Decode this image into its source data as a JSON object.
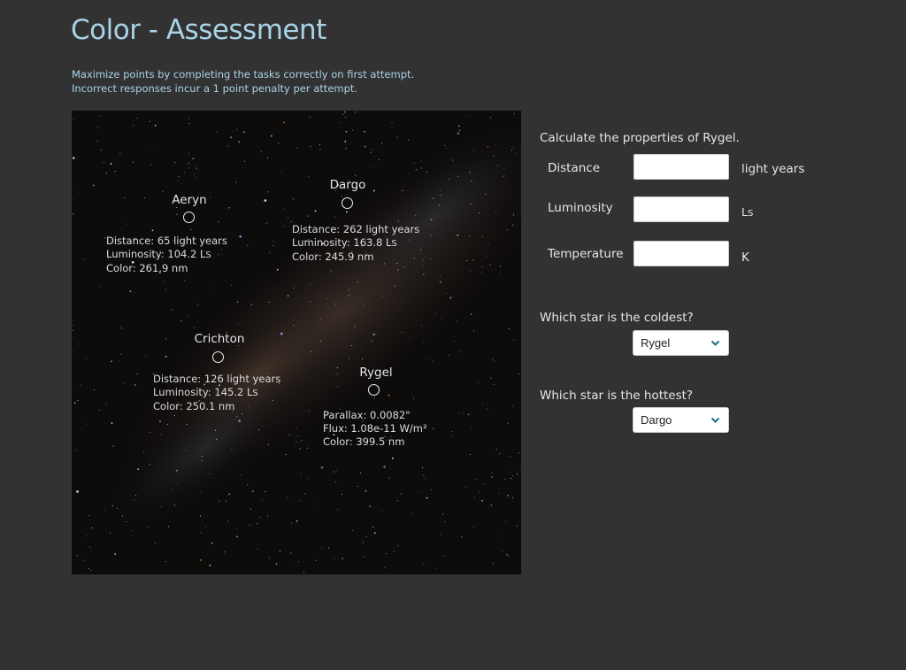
{
  "page": {
    "title": "Color - Assessment",
    "instructions": [
      "Maximize points by completing the tasks correctly on first attempt.",
      "Incorrect responses incur a 1 point penalty per attempt."
    ]
  },
  "stars": {
    "aeryn": {
      "name": "Aeryn",
      "line1": "Distance:  65 light years",
      "line2": "Luminosity:  104.2 L",
      "line2_sub": "S",
      "line3": "Color:  261.9 nm"
    },
    "dargo": {
      "name": "Dargo",
      "line1": "Distance:  262 light years",
      "line2": "Luminosity:  163.8 L",
      "line2_sub": "S",
      "line3": "Color:  245.9 nm"
    },
    "crichton": {
      "name": "Crichton",
      "line1": "Distance:  126 light years",
      "line2": "Luminosity:  145.2 L",
      "line2_sub": "S",
      "line3": "Color:  250.1 nm"
    },
    "rygel": {
      "name": "Rygel",
      "line1": "Parallax:  0.0082\"",
      "line2": "Flux:  1.08e-11 W/m²",
      "line3": "Color:  399.5 nm"
    }
  },
  "task": {
    "prompt": "Calculate the properties of Rygel.",
    "fields": {
      "distance": {
        "label": "Distance",
        "value": "",
        "unit": "light years"
      },
      "luminosity": {
        "label": "Luminosity",
        "value": "",
        "unit": "L",
        "unit_sub": "S"
      },
      "temperature": {
        "label": "Temperature",
        "value": "",
        "unit": "K"
      }
    }
  },
  "questions": {
    "coldest": {
      "prompt": "Which star is the coldest?",
      "selected": "Rygel"
    },
    "hottest": {
      "prompt": "Which star is the hottest?",
      "selected": "Dargo"
    }
  },
  "colors": {
    "background": "#323232",
    "title": "#a9d2e6",
    "select_chevron": "#1a6e8a"
  },
  "icons": {
    "chevron": "chevron-down-icon",
    "marker": "circle-outline-icon"
  }
}
